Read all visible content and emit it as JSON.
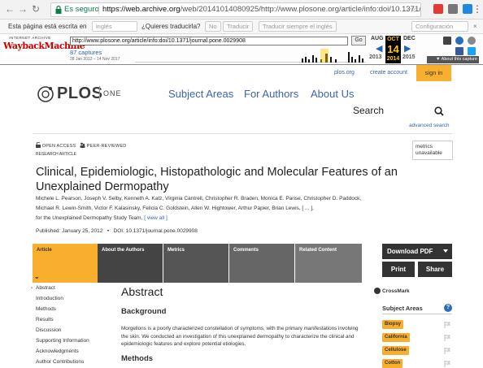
{
  "browser": {
    "secure_label": "Es seguro",
    "url_scheme_host": "https://web.archive.org",
    "url_path": "/web/20141014080925/http://www.plosone.org/article/info:doi/10.1371/journal.pone...",
    "translate_prompt": "Esta página está escrita en",
    "translate_lang": "inglés",
    "translate_question": "¿Quieres traducirla?",
    "translate_no": "No",
    "translate_yes": "Traducir",
    "translate_always": "Traducir siempre el inglés",
    "translate_config": "Configuración"
  },
  "wayback": {
    "ia_label": "INTERNET ARCHIVE",
    "logo": "WaybackMachine",
    "url": "http://www.plosone.org/article/info:doi/10.1371/journal.pone.0029908",
    "go": "Go",
    "captures": "87 captures",
    "range": "28 Jan 2012 – 14 Nov 2017",
    "prev_month": "AUG",
    "cur_month": "OCT",
    "cur_day": "14",
    "cur_year": "2014",
    "next_month": "DEC",
    "prev_year": "2013",
    "next_year": "2015",
    "about": "▼ About this capture"
  },
  "site": {
    "logo": "PLOS",
    "logo_sub": "ONE",
    "nav": [
      "Subject Areas",
      "For Authors",
      "About Us"
    ],
    "top_links": [
      "plos.org",
      "create account"
    ],
    "sign_in": "sign in",
    "search_label": "Search",
    "advanced_search": "advanced search"
  },
  "article": {
    "open_access": "OPEN ACCESS",
    "peer_reviewed": "PEER-REVIEWED",
    "type": "RESEARCH ARTICLE",
    "metrics": "metrics unavailable",
    "title": "Clinical, Epidemiologic, Histopathologic and Molecular Features of an Unexplained Dermopathy",
    "authors_1": "Michele L. Pearson, Joseph V. Selby, Kenneth A. Katz, Virginia Cantrell, Christopher R. Braden, Monica E. Parise, Christopher D. Paddock,",
    "authors_2": "Michael R. Lewin-Smith, Victor F. Kalasinsky, Felicia C. Goldstein, Allen W. Hightower, Arthur Papier, Brian Lewis, [ ... ],",
    "authors_3": "for the Unexplained Dermopathy Study Team,",
    "view_all": "[ view all ]",
    "published": "Published: January 25, 2012",
    "doi": "DOI: 10.1371/journal.pone.0029908"
  },
  "tabs": [
    "Article",
    "About the Authors",
    "Metrics",
    "Comments",
    "Related Content"
  ],
  "actions": {
    "pdf": "Download PDF",
    "print": "Print",
    "share": "Share"
  },
  "sidebar_nav": [
    "Abstract",
    "Introduction",
    "Methods",
    "Results",
    "Discussion",
    "Supporting Information",
    "Acknowledgments",
    "Author Contributions"
  ],
  "content": {
    "abstract": "Abstract",
    "background": "Background",
    "background_text": "Morgellons is a poorly characterized constellation of symptoms, with the primary manifestations involving the skin. We conducted an investigation of this unexplained dermopathy to characterize the clinical and epidemiologic features and explore potential etiologies.",
    "methods": "Methods"
  },
  "right": {
    "crossmark": "CrossMark",
    "subject_areas": "Subject Areas",
    "help": "?",
    "subjects": [
      "Biopsy",
      "California",
      "Cellulose",
      "Cotton"
    ]
  },
  "colors": {
    "accent": "#f8af2d",
    "link": "#3c63af",
    "dark": "#444444"
  }
}
